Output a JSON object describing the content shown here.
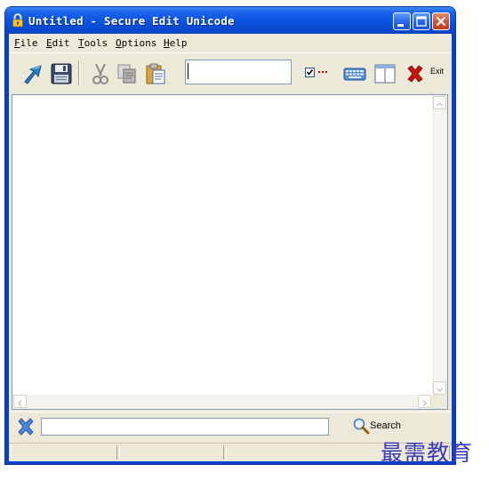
{
  "window": {
    "title": "Untitled - Secure Edit Unicode"
  },
  "menu": [
    {
      "accel": "F",
      "rest": "ile"
    },
    {
      "accel": "E",
      "rest": "dit"
    },
    {
      "accel": "T",
      "rest": "ools"
    },
    {
      "accel": "O",
      "rest": "ptions"
    },
    {
      "accel": "H",
      "rest": "elp"
    }
  ],
  "toolbar": {
    "password_value": "",
    "exit_label": "Exit",
    "checkbox_checked": true,
    "buttons": [
      "open-icon",
      "save-icon",
      "cut-icon",
      "copy-icon",
      "paste-icon",
      "keyboard-icon",
      "window-icon",
      "exit-icon"
    ]
  },
  "editor": {
    "content": ""
  },
  "search": {
    "value": "",
    "button_label": "Search"
  },
  "watermark": "最需教育",
  "colors": {
    "titlebar": "#0a52e0",
    "close_button": "#d55434",
    "client_bg": "#ece9d8",
    "exit_red": "#cc1111"
  }
}
